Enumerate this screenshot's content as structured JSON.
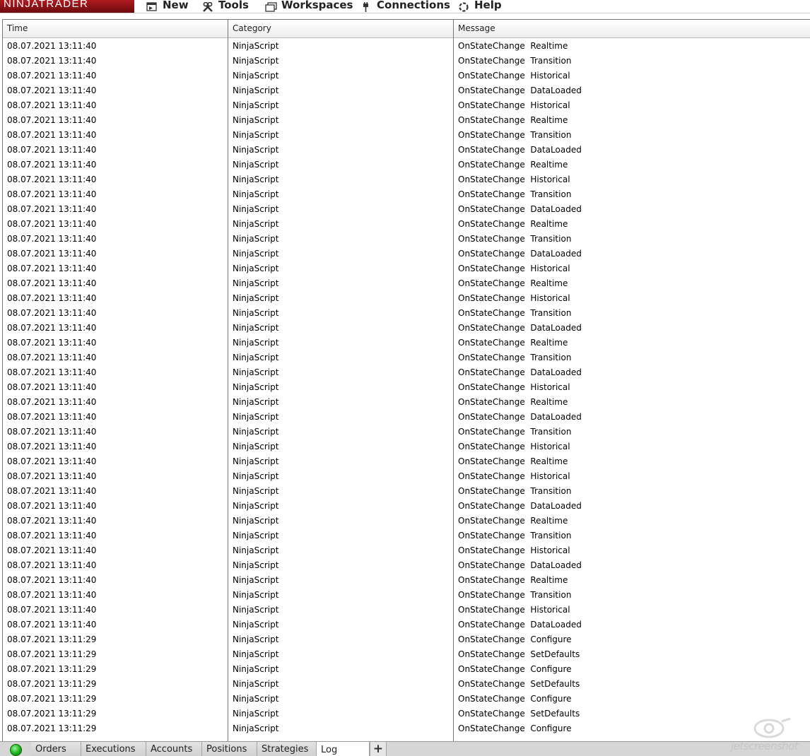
{
  "app": {
    "logo_text": "NINJATRADER"
  },
  "menu": {
    "new_label": "New",
    "tools_label": "Tools",
    "workspaces_label": "Workspaces",
    "connections_label": "Connections",
    "help_label": "Help"
  },
  "log_table": {
    "columns": [
      "Time",
      "Category",
      "Message"
    ],
    "rows": [
      [
        "08.07.2021 13:11:40",
        "NinjaScript",
        "OnStateChange  Realtime"
      ],
      [
        "08.07.2021 13:11:40",
        "NinjaScript",
        "OnStateChange  Transition"
      ],
      [
        "08.07.2021 13:11:40",
        "NinjaScript",
        "OnStateChange  Historical"
      ],
      [
        "08.07.2021 13:11:40",
        "NinjaScript",
        "OnStateChange  DataLoaded"
      ],
      [
        "08.07.2021 13:11:40",
        "NinjaScript",
        "OnStateChange  Historical"
      ],
      [
        "08.07.2021 13:11:40",
        "NinjaScript",
        "OnStateChange  Realtime"
      ],
      [
        "08.07.2021 13:11:40",
        "NinjaScript",
        "OnStateChange  Transition"
      ],
      [
        "08.07.2021 13:11:40",
        "NinjaScript",
        "OnStateChange  DataLoaded"
      ],
      [
        "08.07.2021 13:11:40",
        "NinjaScript",
        "OnStateChange  Realtime"
      ],
      [
        "08.07.2021 13:11:40",
        "NinjaScript",
        "OnStateChange  Historical"
      ],
      [
        "08.07.2021 13:11:40",
        "NinjaScript",
        "OnStateChange  Transition"
      ],
      [
        "08.07.2021 13:11:40",
        "NinjaScript",
        "OnStateChange  DataLoaded"
      ],
      [
        "08.07.2021 13:11:40",
        "NinjaScript",
        "OnStateChange  Realtime"
      ],
      [
        "08.07.2021 13:11:40",
        "NinjaScript",
        "OnStateChange  Transition"
      ],
      [
        "08.07.2021 13:11:40",
        "NinjaScript",
        "OnStateChange  DataLoaded"
      ],
      [
        "08.07.2021 13:11:40",
        "NinjaScript",
        "OnStateChange  Historical"
      ],
      [
        "08.07.2021 13:11:40",
        "NinjaScript",
        "OnStateChange  Realtime"
      ],
      [
        "08.07.2021 13:11:40",
        "NinjaScript",
        "OnStateChange  Historical"
      ],
      [
        "08.07.2021 13:11:40",
        "NinjaScript",
        "OnStateChange  Transition"
      ],
      [
        "08.07.2021 13:11:40",
        "NinjaScript",
        "OnStateChange  DataLoaded"
      ],
      [
        "08.07.2021 13:11:40",
        "NinjaScript",
        "OnStateChange  Realtime"
      ],
      [
        "08.07.2021 13:11:40",
        "NinjaScript",
        "OnStateChange  Transition"
      ],
      [
        "08.07.2021 13:11:40",
        "NinjaScript",
        "OnStateChange  DataLoaded"
      ],
      [
        "08.07.2021 13:11:40",
        "NinjaScript",
        "OnStateChange  Historical"
      ],
      [
        "08.07.2021 13:11:40",
        "NinjaScript",
        "OnStateChange  Realtime"
      ],
      [
        "08.07.2021 13:11:40",
        "NinjaScript",
        "OnStateChange  DataLoaded"
      ],
      [
        "08.07.2021 13:11:40",
        "NinjaScript",
        "OnStateChange  Transition"
      ],
      [
        "08.07.2021 13:11:40",
        "NinjaScript",
        "OnStateChange  Historical"
      ],
      [
        "08.07.2021 13:11:40",
        "NinjaScript",
        "OnStateChange  Realtime"
      ],
      [
        "08.07.2021 13:11:40",
        "NinjaScript",
        "OnStateChange  Historical"
      ],
      [
        "08.07.2021 13:11:40",
        "NinjaScript",
        "OnStateChange  Transition"
      ],
      [
        "08.07.2021 13:11:40",
        "NinjaScript",
        "OnStateChange  DataLoaded"
      ],
      [
        "08.07.2021 13:11:40",
        "NinjaScript",
        "OnStateChange  Realtime"
      ],
      [
        "08.07.2021 13:11:40",
        "NinjaScript",
        "OnStateChange  Transition"
      ],
      [
        "08.07.2021 13:11:40",
        "NinjaScript",
        "OnStateChange  Historical"
      ],
      [
        "08.07.2021 13:11:40",
        "NinjaScript",
        "OnStateChange  DataLoaded"
      ],
      [
        "08.07.2021 13:11:40",
        "NinjaScript",
        "OnStateChange  Realtime"
      ],
      [
        "08.07.2021 13:11:40",
        "NinjaScript",
        "OnStateChange  Transition"
      ],
      [
        "08.07.2021 13:11:40",
        "NinjaScript",
        "OnStateChange  Historical"
      ],
      [
        "08.07.2021 13:11:40",
        "NinjaScript",
        "OnStateChange  DataLoaded"
      ],
      [
        "08.07.2021 13:11:29",
        "NinjaScript",
        "OnStateChange  Configure"
      ],
      [
        "08.07.2021 13:11:29",
        "NinjaScript",
        "OnStateChange  SetDefaults"
      ],
      [
        "08.07.2021 13:11:29",
        "NinjaScript",
        "OnStateChange  Configure"
      ],
      [
        "08.07.2021 13:11:29",
        "NinjaScript",
        "OnStateChange  SetDefaults"
      ],
      [
        "08.07.2021 13:11:29",
        "NinjaScript",
        "OnStateChange  Configure"
      ],
      [
        "08.07.2021 13:11:29",
        "NinjaScript",
        "OnStateChange  SetDefaults"
      ],
      [
        "08.07.2021 13:11:29",
        "NinjaScript",
        "OnStateChange  Configure"
      ]
    ]
  },
  "tabs": {
    "items": [
      "Orders",
      "Executions",
      "Accounts",
      "Positions",
      "Strategies",
      "Log"
    ],
    "active": "Log",
    "add_label": "+"
  },
  "status": {
    "connection_color": "#17b017"
  },
  "watermark": {
    "text": "jetscreenshot"
  }
}
